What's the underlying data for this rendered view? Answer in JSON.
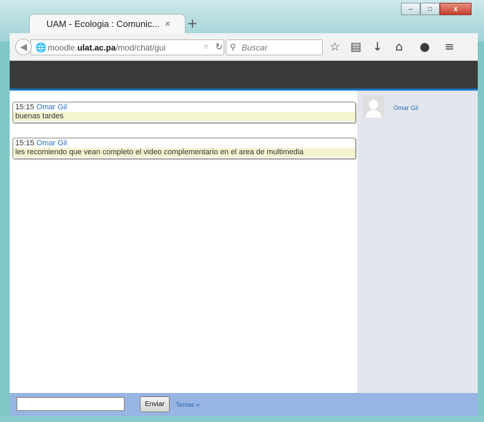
{
  "browser": {
    "tab_title": "UAM - Ecologia : Comunic...",
    "tab_close": "×",
    "new_tab": "+",
    "url_prefix": "moodle.",
    "url_domain": "ulat.ac.pa",
    "url_path": "/mod/chat/gui",
    "search_placeholder": "Buscar",
    "window_controls": {
      "minimize": "–",
      "maximize": "□",
      "close": "x"
    }
  },
  "chat": {
    "messages": [
      {
        "time": "15:15",
        "author": "Omar Gil",
        "text": "buenas tardes"
      },
      {
        "time": "15:15",
        "author": "Omar Gil",
        "text": "les recomiendo que vean completo el video complementario en el area de multimedia"
      }
    ],
    "users": [
      {
        "name": "Omar Gil"
      }
    ],
    "input": {
      "value": ""
    },
    "send_label": "Enviar",
    "themes_label": "Temas »"
  },
  "colors": {
    "accent": "#1a78c2",
    "header_bar": "#3a3a3a",
    "input_bar": "#97b5e2",
    "message_highlight": "#f4f3cf",
    "link": "#2a6fbf"
  },
  "icons": [
    "back-arrow-icon",
    "globe-icon",
    "dropdown-icon",
    "reload-icon",
    "search-icon",
    "star-icon",
    "clipboard-icon",
    "download-icon",
    "home-icon",
    "chat-bubble-icon",
    "menu-icon"
  ]
}
